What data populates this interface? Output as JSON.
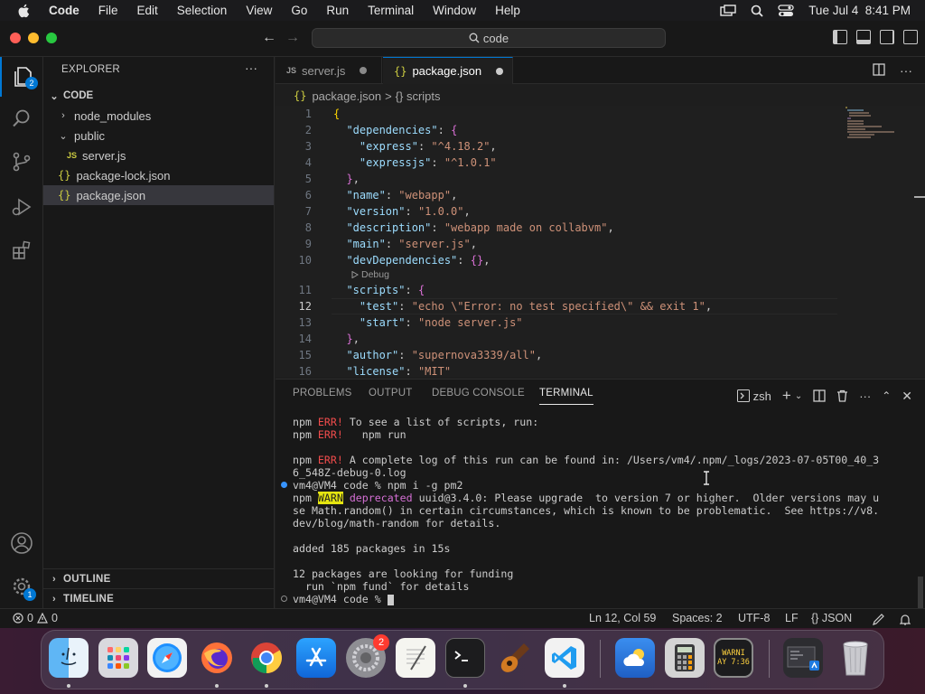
{
  "menubar": {
    "app": "Code",
    "items": [
      "File",
      "Edit",
      "Selection",
      "View",
      "Go",
      "Run",
      "Terminal",
      "Window",
      "Help"
    ],
    "clock": "Tue Jul 4  8:41 PM"
  },
  "window": {
    "search_label": "code"
  },
  "activity": {
    "explorer_badge": "2",
    "manage_badge": "1"
  },
  "sidebar": {
    "title": "EXPLORER",
    "more": "···",
    "folder": "CODE",
    "tree": {
      "node_modules": "node_modules",
      "public": "public",
      "server_js": "server.js",
      "package_lock": "package-lock.json",
      "package_json": "package.json"
    },
    "outline": "OUTLINE",
    "timeline": "TIMELINE"
  },
  "tabs": [
    {
      "label": "server.js",
      "icon": "JS"
    },
    {
      "label": "package.json",
      "icon": "{}"
    }
  ],
  "breadcrumb": {
    "file": "package.json",
    "sep": ">",
    "symbol": "{} scripts"
  },
  "editor": {
    "line_numbers": [
      "1",
      "2",
      "3",
      "4",
      "5",
      "6",
      "7",
      "8",
      "9",
      "10",
      "11",
      "12",
      "13",
      "14",
      "15",
      "16"
    ],
    "current_line": 12,
    "codelens": "Debug",
    "lines": {
      "l1": "{",
      "l2k": "\"dependencies\"",
      "l2p": ": ",
      "l2b": "{",
      "l3k": "\"express\"",
      "l3p": ": ",
      "l3s": "\"^4.18.2\"",
      "l3c": ",",
      "l4k": "\"expressjs\"",
      "l4p": ": ",
      "l4s": "\"^1.0.1\"",
      "l5b": "}",
      "l5c": ",",
      "l6k": "\"name\"",
      "l6p": ": ",
      "l6s": "\"webapp\"",
      "l6c": ",",
      "l7k": "\"version\"",
      "l7p": ": ",
      "l7s": "\"1.0.0\"",
      "l7c": ",",
      "l8k": "\"description\"",
      "l8p": ": ",
      "l8s": "\"webapp made on collabvm\"",
      "l8c": ",",
      "l9k": "\"main\"",
      "l9p": ": ",
      "l9s": "\"server.js\"",
      "l9c": ",",
      "l10k": "\"devDependencies\"",
      "l10p": ": ",
      "l10b": "{}",
      "l10c": ",",
      "l11k": "\"scripts\"",
      "l11p": ": ",
      "l11b": "{",
      "l12k": "\"test\"",
      "l12p": ": ",
      "l12s": "\"echo \\\"Error: no test specified\\\" && exit 1\"",
      "l12c": ",",
      "l13k": "\"start\"",
      "l13p": ": ",
      "l13s": "\"node server.js\"",
      "l14b": "}",
      "l14c": ",",
      "l15k": "\"author\"",
      "l15p": ": ",
      "l15s": "\"supernova3339/all\"",
      "l15c": ",",
      "l16k": "\"license\"",
      "l16p": ": ",
      "l16s": "\"MIT\""
    }
  },
  "panel": {
    "tabs": [
      "PROBLEMS",
      "OUTPUT",
      "DEBUG CONSOLE",
      "TERMINAL"
    ],
    "shell": "zsh",
    "terminal": {
      "t1a": "npm ",
      "t1b": "ERR!",
      "t1c": " To see a list of scripts, run:",
      "t2a": "npm ",
      "t2b": "ERR!",
      "t2c": "   npm run",
      "t3a": "npm ",
      "t3b": "ERR!",
      "t3c": " A complete log of this run can be found in: /Users/vm4/.npm/_logs/2023-07-05T00_40_3",
      "t4": "6_548Z-debug-0.log",
      "t5": "vm4@VM4 code % npm i -g pm2",
      "t6a": "npm ",
      "t6b": "WARN",
      "t6c": " deprecated",
      "t6d": " uuid@3.4.0: Please upgrade  to version 7 or higher.  Older versions may u",
      "t7": "se Math.random() in certain circumstances, which is known to be problematic.  See https://v8.",
      "t8": "dev/blog/math-random for details.",
      "t9": "added 185 packages in 15s",
      "t10": "12 packages are looking for funding",
      "t11": "  run `npm fund` for details",
      "t12": "vm4@VM4 code % "
    }
  },
  "statusbar": {
    "errors": "0",
    "warnings": "0",
    "position": "Ln 12, Col 59",
    "spaces": "Spaces: 2",
    "encoding": "UTF-8",
    "eol": "LF",
    "language": "{} JSON"
  },
  "dock": {
    "settings_badge": "2",
    "console_label": "WARNI\nAY 7:36"
  }
}
